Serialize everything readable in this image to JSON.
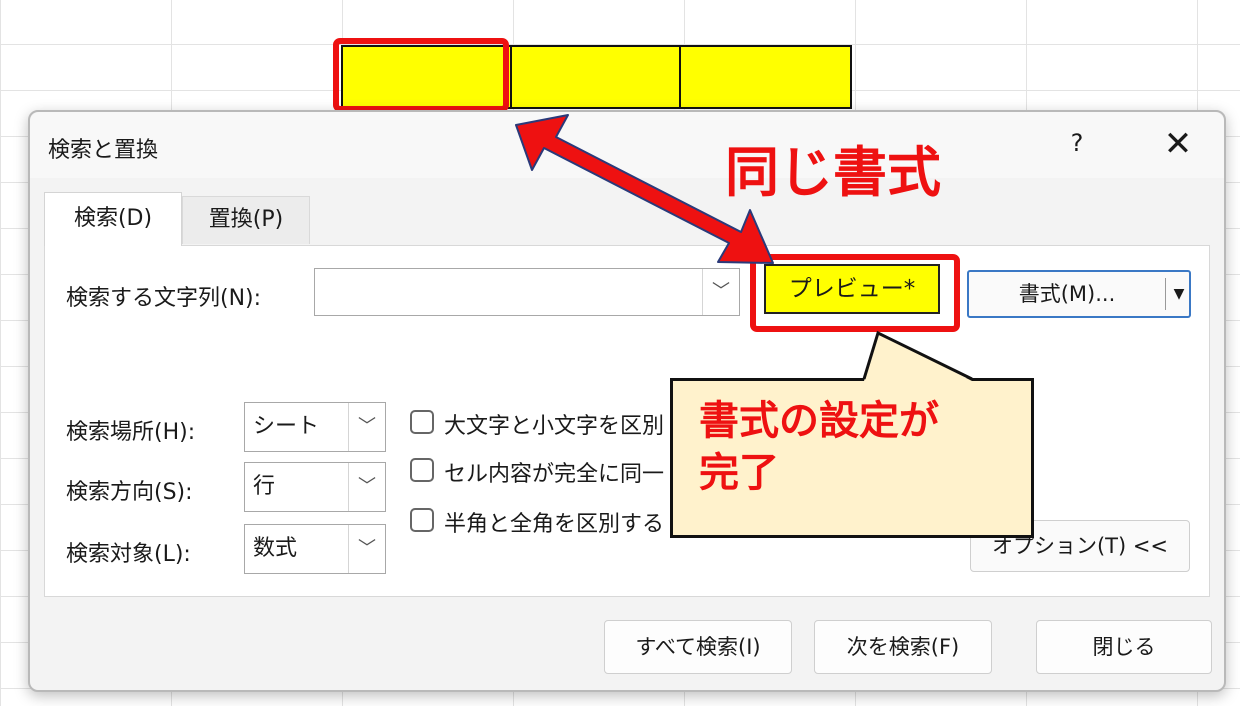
{
  "dialog": {
    "title": "検索と置換",
    "help_label": "?",
    "close_label": "✕",
    "tabs": [
      {
        "label": "検索(D)"
      },
      {
        "label": "置換(P)"
      }
    ],
    "search_label": "検索する文字列(N):",
    "search_value": "",
    "preview_label": "プレビュー*",
    "format_button": "書式(M)...",
    "fields": [
      {
        "label": "検索場所(H):",
        "value": "シート"
      },
      {
        "label": "検索方向(S):",
        "value": "行"
      },
      {
        "label": "検索対象(L):",
        "value": "数式"
      }
    ],
    "checkboxes": [
      {
        "label": "大文字と小文字を区別",
        "checked": false
      },
      {
        "label": "セル内容が完全に同一",
        "checked": false
      },
      {
        "label": "半角と全角を区別する",
        "checked": false
      }
    ],
    "options_button": "オプション(T) <<",
    "buttons": {
      "find_all": "すべて検索(I)",
      "find_next": "次を検索(F)",
      "close": "閉じる"
    }
  },
  "annotations": {
    "same_format": "同じ書式",
    "callout_line1": "書式の設定が",
    "callout_line2": "完了",
    "highlight_color": "#ee1111",
    "cell_color": "#ffff00"
  }
}
